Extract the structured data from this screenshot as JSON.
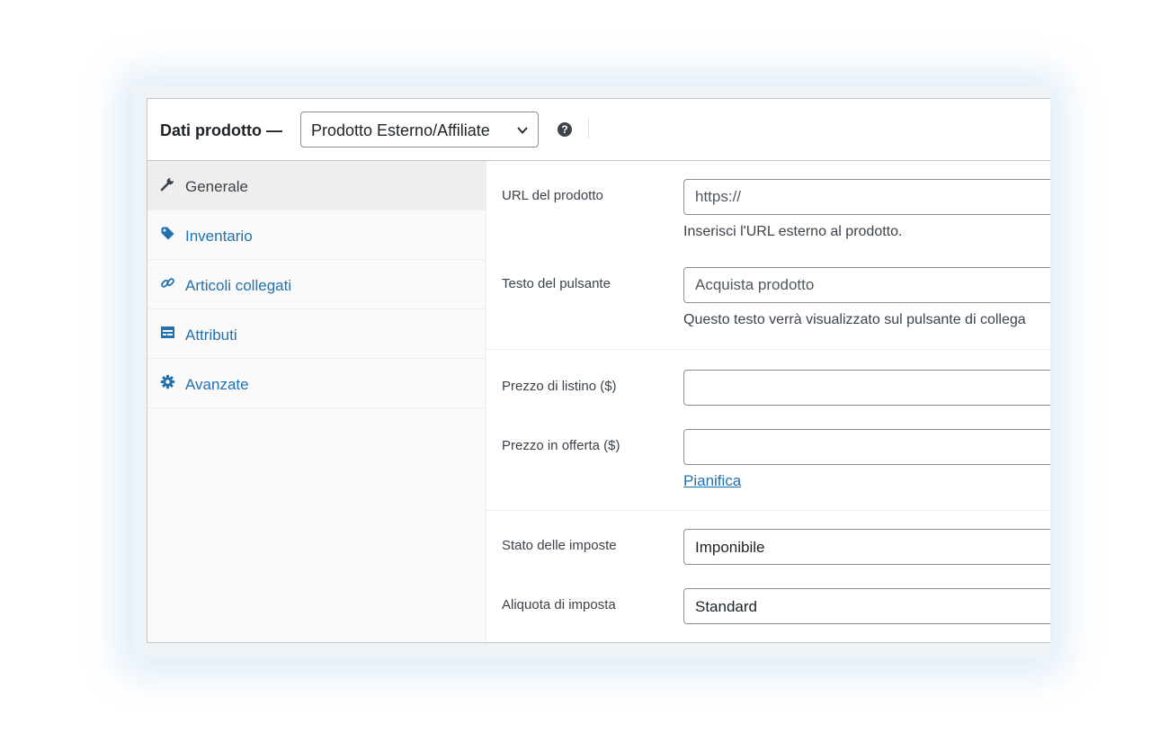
{
  "header": {
    "title": "Dati prodotto —",
    "product_type": "Prodotto Esterno/Affiliate",
    "help_icon": "question-circle-icon"
  },
  "tabs": [
    {
      "label": "Generale",
      "icon": "wrench-icon",
      "active": true
    },
    {
      "label": "Inventario",
      "icon": "tag-icon",
      "active": false
    },
    {
      "label": "Articoli collegati",
      "icon": "link-icon",
      "active": false
    },
    {
      "label": "Attributi",
      "icon": "table-icon",
      "active": false
    },
    {
      "label": "Avanzate",
      "icon": "gear-icon",
      "active": false
    }
  ],
  "fields": {
    "product_url": {
      "label": "URL del prodotto",
      "placeholder": "https://",
      "description": "Inserisci l'URL esterno al prodotto."
    },
    "button_text": {
      "label": "Testo del pulsante",
      "placeholder": "Acquista prodotto",
      "description": "Questo testo verrà visualizzato sul pulsante di collega"
    },
    "regular_price": {
      "label": "Prezzo di listino ($)",
      "value": ""
    },
    "sale_price": {
      "label": "Prezzo in offerta ($)",
      "value": "",
      "schedule_link": "Pianifica"
    },
    "tax_status": {
      "label": "Stato delle imposte",
      "value": "Imponibile"
    },
    "tax_class": {
      "label": "Aliquota di imposta",
      "value": "Standard"
    }
  },
  "colors": {
    "link": "#2271b1",
    "text": "#3c434a",
    "border": "#8c8f94",
    "tab_active_bg": "#eeeeee"
  }
}
